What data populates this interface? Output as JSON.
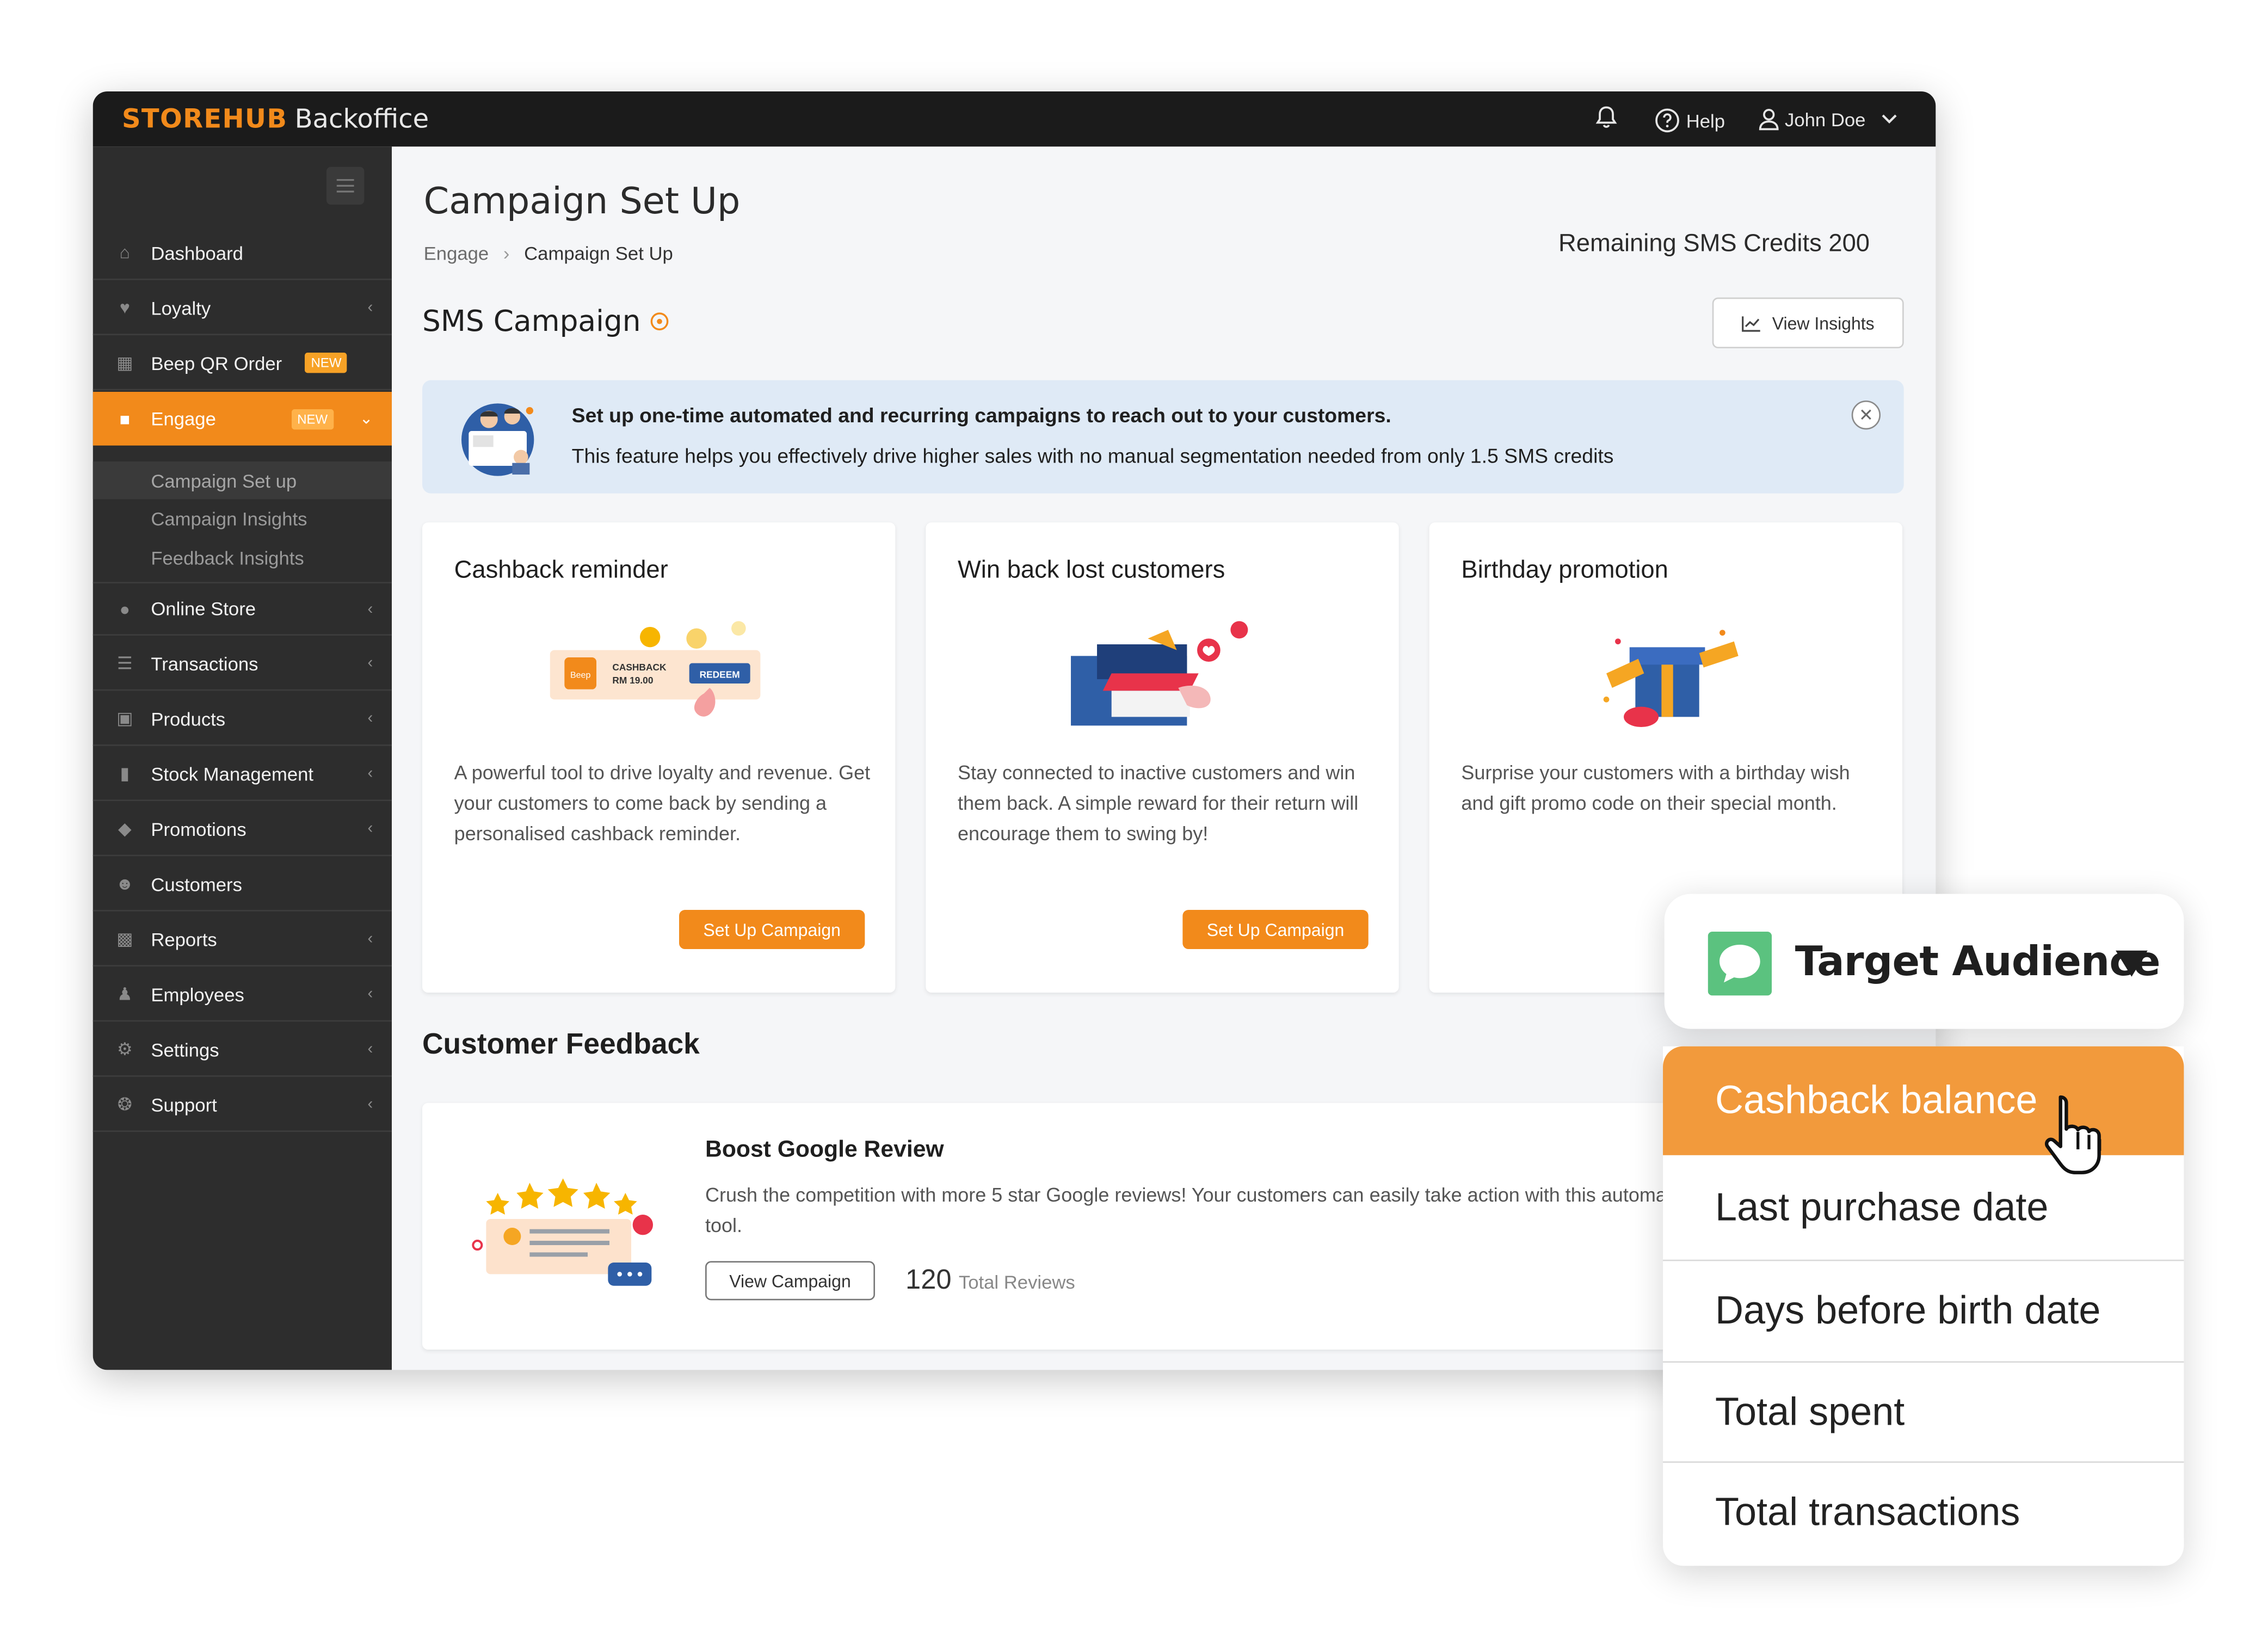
{
  "brand": {
    "logo_strong": "STOREHUB",
    "logo_rest": "Backoffice"
  },
  "topbar": {
    "help_label": "Help",
    "user_name": "John Doe"
  },
  "sidebar": {
    "items": [
      {
        "label": "Dashboard",
        "icon": "home-icon"
      },
      {
        "label": "Loyalty",
        "icon": "heart-icon"
      },
      {
        "label": "Beep QR Order",
        "icon": "qr-icon",
        "badge": "NEW"
      },
      {
        "label": "Engage",
        "icon": "chat-icon",
        "badge": "NEW"
      },
      {
        "label": "Online Store",
        "icon": "globe-icon"
      },
      {
        "label": "Transactions",
        "icon": "list-icon"
      },
      {
        "label": "Products",
        "icon": "cart-icon"
      },
      {
        "label": "Stock Management",
        "icon": "barcode-icon"
      },
      {
        "label": "Promotions",
        "icon": "tag-icon"
      },
      {
        "label": "Customers",
        "icon": "users-icon"
      },
      {
        "label": "Reports",
        "icon": "chart-icon"
      },
      {
        "label": "Employees",
        "icon": "person-icon"
      },
      {
        "label": "Settings",
        "icon": "gear-icon"
      },
      {
        "label": "Support",
        "icon": "support-icon"
      }
    ],
    "engage_sub": [
      "Campaign Set up",
      "Campaign Insights",
      "Feedback Insights"
    ]
  },
  "main": {
    "title": "Campaign Set Up",
    "breadcrumb": [
      "Engage",
      "Campaign Set Up"
    ],
    "credits": "Remaining SMS Credits 200",
    "sms_heading": "SMS Campaign",
    "view_insights": "View Insights",
    "banner": {
      "title": "Set up one-time automated and recurring campaigns to reach out to your customers.",
      "text": "This feature helps you effectively drive higher sales with no manual segmentation needed from only 1.5 SMS credits"
    },
    "cards": [
      {
        "title": "Cashback reminder",
        "desc": "A powerful tool to drive loyalty and revenue. Get your customers to come back by sending a personalised cashback reminder.",
        "button": "Set Up Campaign",
        "illus": {
          "cashback": "CASHBACK",
          "amount": "RM 19.00",
          "redeem": "REDEEM",
          "beep": "Beep"
        }
      },
      {
        "title": "Win back lost customers",
        "desc": "Stay connected to inactive customers and win them back. A simple reward for their return will encourage them to swing by!",
        "button": "Set Up Campaign"
      },
      {
        "title": "Birthday promotion",
        "desc": "Surprise your customers with a birthday wish and gift promo code on their special month."
      }
    ],
    "feedback_heading": "Customer Feedback",
    "feedback": {
      "title": "Boost Google Review",
      "desc": "Crush the competition with more 5 star Google reviews! Your customers can easily take action with this automated tool.",
      "button": "View Campaign",
      "count": "120",
      "count_label": "Total Reviews"
    }
  },
  "overlay": {
    "label": "Target Audience",
    "options": [
      "Cashback balance",
      "Last purchase date",
      "Days before birth date",
      "Total spent",
      "Total transactions"
    ],
    "selected": "Cashback balance"
  },
  "colors": {
    "accent": "#f28a1b",
    "sidebar": "#2d2d2d",
    "topbar": "#1b1b1b",
    "banner": "#dfeaf6",
    "highlight": "#f29a3c"
  }
}
